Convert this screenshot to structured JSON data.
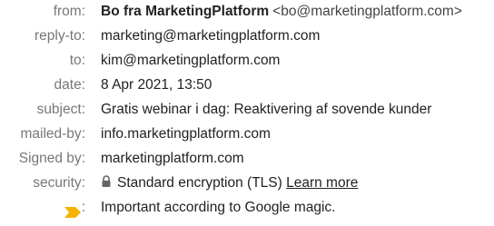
{
  "email_details": {
    "from": {
      "label": "from",
      "name": "Bo fra MarketingPlatform",
      "email": "<bo@marketingplatform.com>"
    },
    "reply_to": {
      "label": "reply-to",
      "value": "marketing@marketingplatform.com"
    },
    "to": {
      "label": "to",
      "value": "kim@marketingplatform.com"
    },
    "date": {
      "label": "date",
      "value": "8 Apr 2021, 13:50"
    },
    "subject": {
      "label": "subject",
      "value": "Gratis webinar i dag: Reaktivering af sovende kunder"
    },
    "mailed_by": {
      "label": "mailed-by",
      "value": "info.marketingplatform.com"
    },
    "signed_by": {
      "label": "Signed by",
      "value": "marketingplatform.com"
    },
    "security": {
      "label": "security",
      "icon": "lock-icon",
      "value": "Standard encryption (TLS)",
      "link": "Learn more"
    },
    "importance": {
      "icon": "importance-marker-icon",
      "icon_color": "#F4B400",
      "value": "Important according to Google magic."
    }
  }
}
